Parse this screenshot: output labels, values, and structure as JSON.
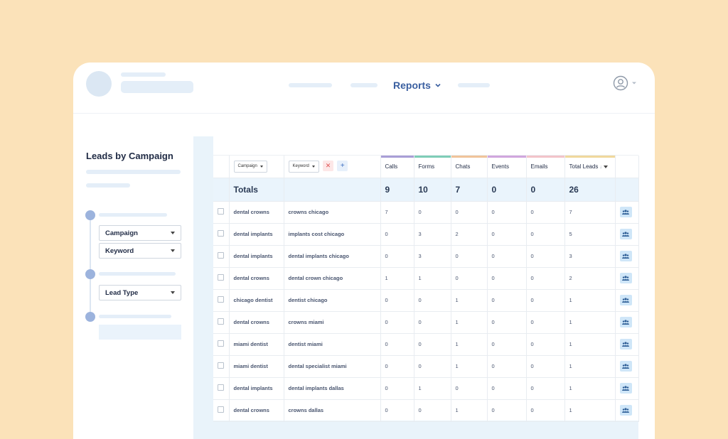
{
  "header": {
    "reports_label": "Reports"
  },
  "sidebar": {
    "title": "Leads by Campaign",
    "selects": {
      "campaign": "Campaign",
      "keyword": "Keyword",
      "lead_type": "Lead Type"
    }
  },
  "table": {
    "filters": {
      "campaign": "Campaign",
      "keyword": "Keyword"
    },
    "buttons": {
      "remove": "✕",
      "add": "+"
    },
    "columns": [
      "Calls",
      "Forms",
      "Chats",
      "Events",
      "Emails",
      "Total Leads"
    ],
    "metric_colors": [
      "#a99ed6",
      "#7fcdb7",
      "#f0c49a",
      "#d0a6dd",
      "#f2c4c9",
      "#f0d89c"
    ],
    "totals": {
      "label": "Totals",
      "values": [
        "9",
        "10",
        "7",
        "0",
        "0",
        "26"
      ]
    },
    "rows": [
      {
        "campaign": "dental crowns",
        "keyword": "crowns chicago",
        "values": [
          "7",
          "0",
          "0",
          "0",
          "0",
          "7"
        ]
      },
      {
        "campaign": "dental implants",
        "keyword": "implants cost chicago",
        "values": [
          "0",
          "3",
          "2",
          "0",
          "0",
          "5"
        ]
      },
      {
        "campaign": "dental implants",
        "keyword": "dental implants chicago",
        "values": [
          "0",
          "3",
          "0",
          "0",
          "0",
          "3"
        ]
      },
      {
        "campaign": "dental crowns",
        "keyword": "dental crown chicago",
        "values": [
          "1",
          "1",
          "0",
          "0",
          "0",
          "2"
        ]
      },
      {
        "campaign": "chicago dentist",
        "keyword": "dentist chicago",
        "values": [
          "0",
          "0",
          "1",
          "0",
          "0",
          "1"
        ]
      },
      {
        "campaign": "dental crowns",
        "keyword": "crowns miami",
        "values": [
          "0",
          "0",
          "1",
          "0",
          "0",
          "1"
        ]
      },
      {
        "campaign": "miami dentist",
        "keyword": "dentist miami",
        "values": [
          "0",
          "0",
          "1",
          "0",
          "0",
          "1"
        ]
      },
      {
        "campaign": "miami dentist",
        "keyword": "dental specialist miami",
        "values": [
          "0",
          "0",
          "1",
          "0",
          "0",
          "1"
        ]
      },
      {
        "campaign": "dental implants",
        "keyword": "dental implants dallas",
        "values": [
          "0",
          "1",
          "0",
          "0",
          "0",
          "1"
        ]
      },
      {
        "campaign": "dental crowns",
        "keyword": "crowns dallas",
        "values": [
          "0",
          "0",
          "1",
          "0",
          "0",
          "1"
        ]
      }
    ]
  },
  "icons": {
    "reports_chevron": "chevron-down-icon",
    "user": "user-icon",
    "row_action": "contacts-icon"
  }
}
